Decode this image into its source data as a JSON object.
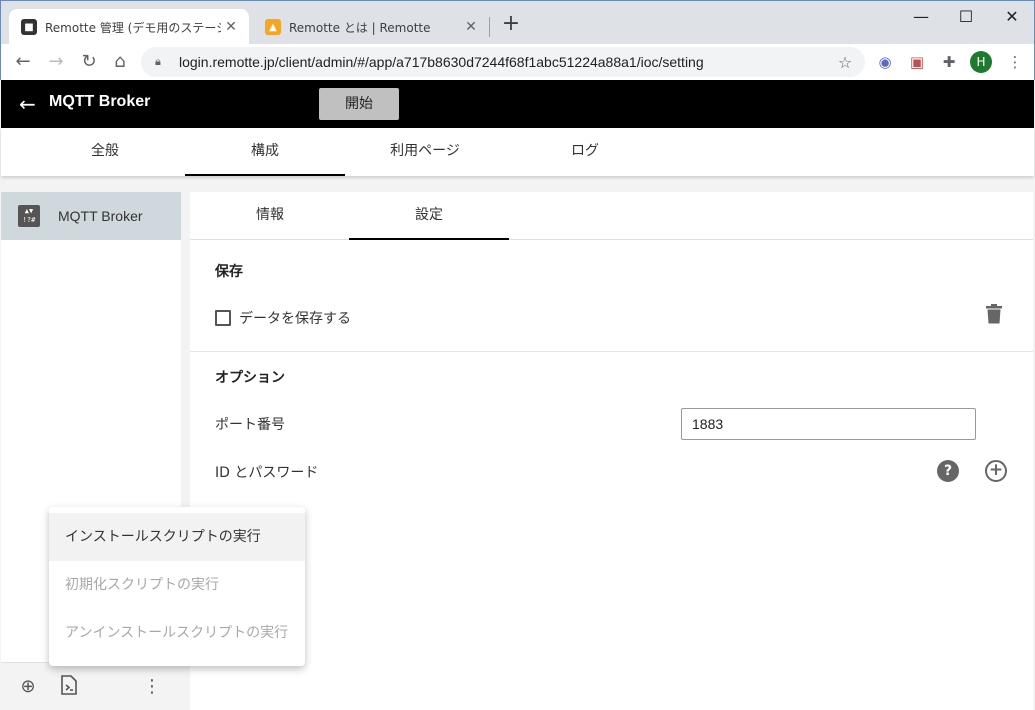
{
  "browser": {
    "tabs": [
      {
        "title": "Remotte 管理 (デモ用のステーション)",
        "favicon": "remotte-admin-icon"
      },
      {
        "title": "Remotte とは | Remotte",
        "favicon": "remotte-icon"
      }
    ],
    "url": "login.remotte.jp/client/admin/#/app/a717b8630d7244f68f1abc51224a88a1/ioc/setting",
    "profile_initial": "H"
  },
  "header": {
    "title": "MQTT Broker",
    "start_label": "開始"
  },
  "main_tabs": [
    "全般",
    "構成",
    "利用ページ",
    "ログ"
  ],
  "sidebar": {
    "items": [
      {
        "label": "MQTT Broker",
        "icon": "node-icon"
      }
    ]
  },
  "sub_tabs": [
    "情報",
    "設定"
  ],
  "settings": {
    "save_section": "保存",
    "save_checkbox_label": "データを保存する",
    "options_section": "オプション",
    "port_label": "ポート番号",
    "port_value": "1883",
    "auth_label": "ID とパスワード"
  },
  "menu": {
    "items": [
      {
        "label": "インストールスクリプトの実行",
        "state": "hover"
      },
      {
        "label": "初期化スクリプトの実行",
        "state": "disabled"
      },
      {
        "label": "アンインストールスクリプトの実行",
        "state": "disabled"
      }
    ]
  }
}
